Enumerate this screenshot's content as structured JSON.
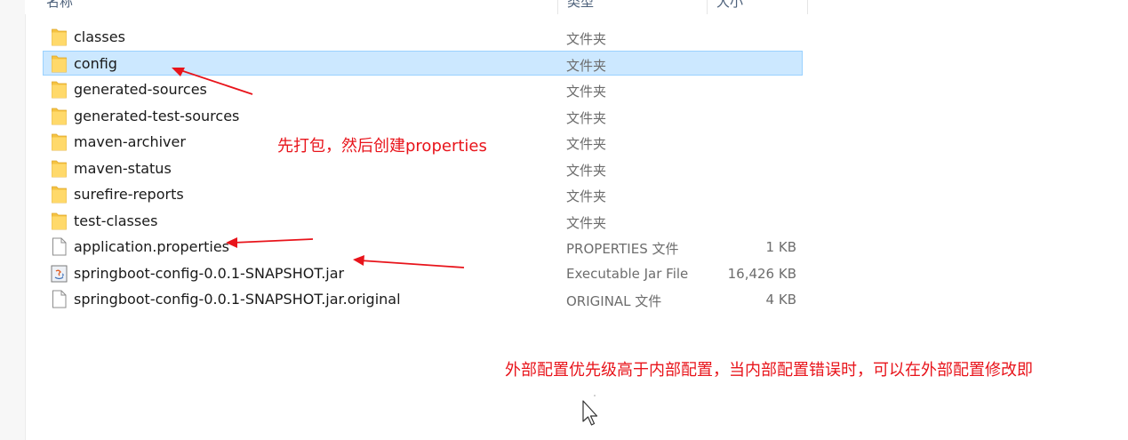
{
  "columns": {
    "name": "名称",
    "type": "类型",
    "size": "大小"
  },
  "files": [
    {
      "name": "classes",
      "type": "文件夹",
      "size": "",
      "icon": "folder-icon",
      "selected": false
    },
    {
      "name": "config",
      "type": "文件夹",
      "size": "",
      "icon": "folder-icon",
      "selected": true
    },
    {
      "name": "generated-sources",
      "type": "文件夹",
      "size": "",
      "icon": "folder-icon",
      "selected": false
    },
    {
      "name": "generated-test-sources",
      "type": "文件夹",
      "size": "",
      "icon": "folder-icon",
      "selected": false
    },
    {
      "name": "maven-archiver",
      "type": "文件夹",
      "size": "",
      "icon": "folder-icon",
      "selected": false
    },
    {
      "name": "maven-status",
      "type": "文件夹",
      "size": "",
      "icon": "folder-icon",
      "selected": false
    },
    {
      "name": "surefire-reports",
      "type": "文件夹",
      "size": "",
      "icon": "folder-icon",
      "selected": false
    },
    {
      "name": "test-classes",
      "type": "文件夹",
      "size": "",
      "icon": "folder-icon",
      "selected": false
    },
    {
      "name": "application.properties",
      "type": "PROPERTIES 文件",
      "size": "1 KB",
      "icon": "file-icon",
      "selected": false
    },
    {
      "name": "springboot-config-0.0.1-SNAPSHOT.jar",
      "type": "Executable Jar File",
      "size": "16,426 KB",
      "icon": "jar-icon",
      "selected": false
    },
    {
      "name": "springboot-config-0.0.1-SNAPSHOT.jar.original",
      "type": "ORIGINAL 文件",
      "size": "4 KB",
      "icon": "file-icon",
      "selected": false
    }
  ],
  "annotations": {
    "note1": "先打包，然后创建properties",
    "note2": "外部配置优先级高于内部配置，当内部配置错误时，可以在外部配置修改即"
  },
  "colors": {
    "selection_bg": "#cce8ff",
    "selection_border": "#99d1ff",
    "annotation": "#e8141b",
    "folder": "#f5c342"
  }
}
